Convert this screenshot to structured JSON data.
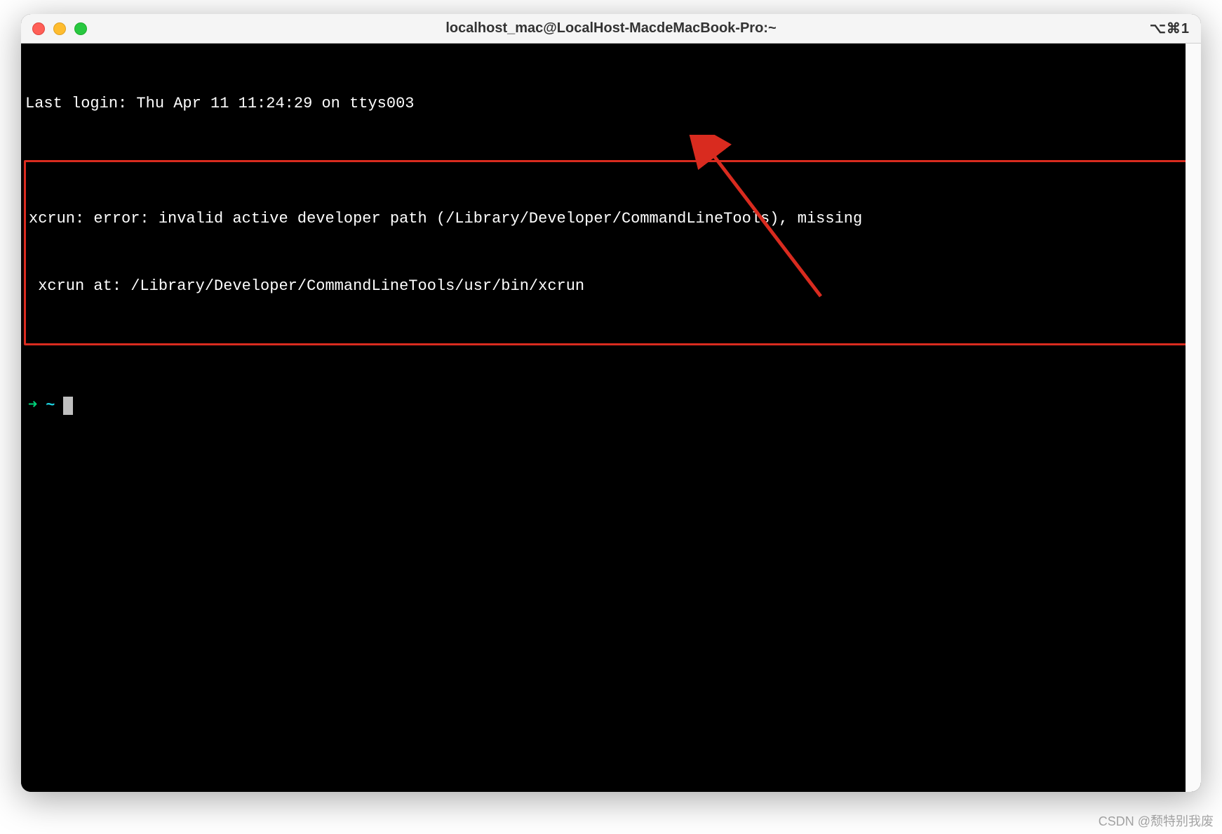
{
  "window": {
    "title": "localhost_mac@LocalHost-MacdeMacBook-Pro:~",
    "shortcut": "⌥⌘1"
  },
  "terminal": {
    "last_login": "Last login: Thu Apr 11 11:24:29 on ttys003",
    "error_line1": "xcrun: error: invalid active developer path (/Library/Developer/CommandLineTools), missing",
    "error_line2": " xcrun at: /Library/Developer/CommandLineTools/usr/bin/xcrun",
    "prompt_arrow": "➜",
    "prompt_path": "~"
  },
  "watermark": "CSDN @颓特别我废"
}
